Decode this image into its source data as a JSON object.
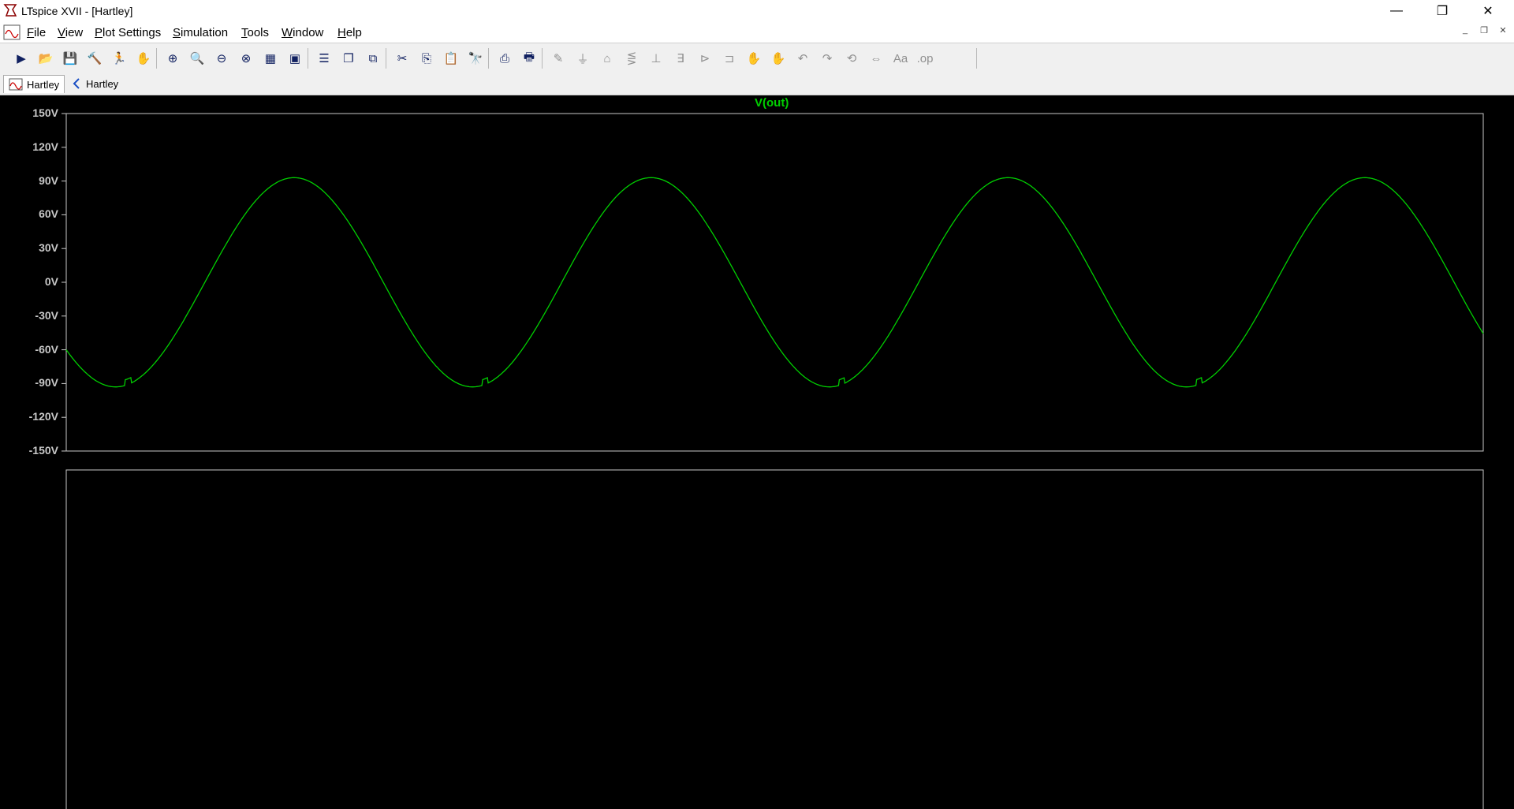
{
  "window": {
    "title": "LTspice XVII - [Hartley]"
  },
  "menu": [
    "File",
    "View",
    "Plot Settings",
    "Simulation",
    "Tools",
    "Window",
    "Help"
  ],
  "menu_accel": [
    "F",
    "V",
    "P",
    "S",
    "T",
    "W",
    "H"
  ],
  "tabs": [
    {
      "label": "Hartley",
      "icon": "waveform-icon",
      "active": true
    },
    {
      "label": "Hartley",
      "icon": "schematic-icon",
      "active": false
    }
  ],
  "toolbar": [
    "run-icon",
    "open-icon",
    "save-icon",
    "control-panel-icon",
    "run-man-icon",
    "pan-hand-icon",
    "zoom-in-icon",
    "zoom-back-icon",
    "zoom-out-icon",
    "zoom-fit-icon",
    "autorange-icon",
    "add-trace-icon",
    "tile-horizontal-icon",
    "cascade-icon",
    "tile-vertical-icon",
    "cut-icon",
    "copy-icon",
    "paste-icon",
    "find-icon",
    "print-icon",
    "print-preview-icon",
    "wire-icon",
    "ground-icon",
    "label-net-icon",
    "resistor-icon",
    "capacitor-icon",
    "inductor-icon",
    "diode-icon",
    "component-icon",
    "move-icon",
    "drag-icon",
    "undo-icon",
    "redo-icon",
    "rotate-icon",
    "mirror-icon",
    "text-icon",
    "spice-directive-icon"
  ],
  "chart_data": {
    "type": "line",
    "title": "V(out)",
    "ylim": [
      -150,
      150
    ],
    "yticks": [
      "150V",
      "120V",
      "90V",
      "60V",
      "30V",
      "0V",
      "-30V",
      "-60V",
      "-90V",
      "-120V",
      "-150V"
    ],
    "series": [
      {
        "name": "V(out)",
        "color": "#00d000",
        "amplitude": 93,
        "cycles": 3.97,
        "phase_start": -60,
        "end_value": -42
      }
    ],
    "grid": false
  }
}
